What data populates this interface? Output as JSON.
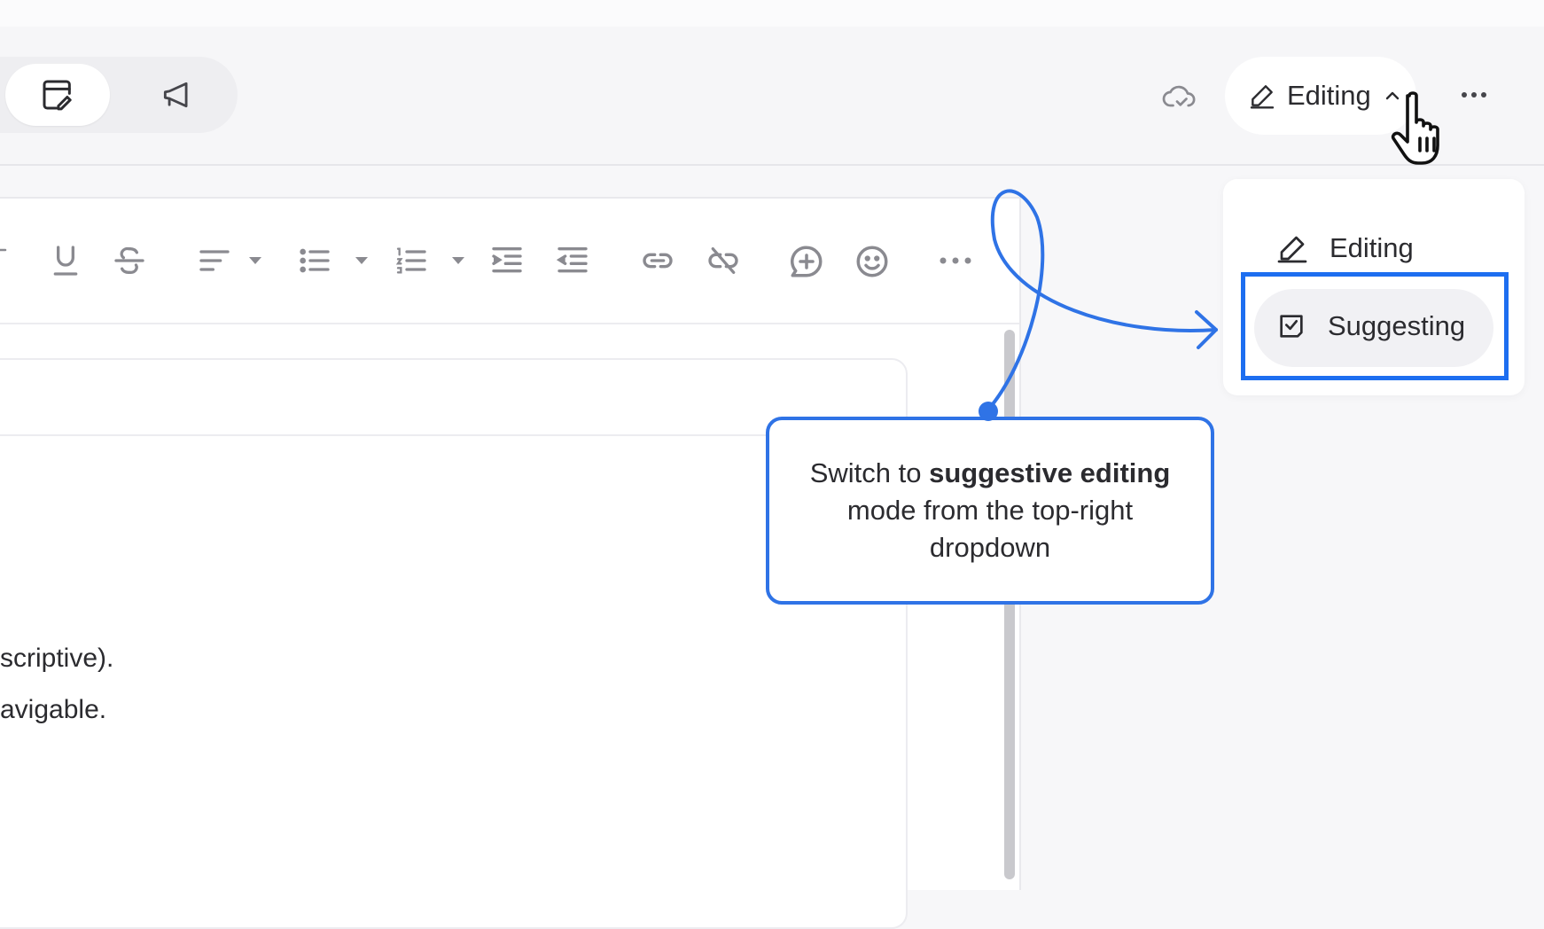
{
  "topbar": {
    "view_toggle": [
      {
        "icon": "edit-document-icon",
        "active": true
      },
      {
        "icon": "megaphone-icon",
        "active": false
      }
    ],
    "sync_icon": "cloud-check-icon",
    "mode_button": {
      "icon": "pencil-icon",
      "label": "Editing",
      "chevron": "chevron-up-icon"
    },
    "more_icon": "more-horizontal-icon"
  },
  "toolbar": {
    "tools": [
      "underline-icon",
      "strikethrough-icon",
      "align-icon",
      "bullet-list-icon",
      "numbered-list-icon",
      "indent-icon",
      "outdent-icon",
      "link-icon",
      "unlink-icon",
      "add-comment-icon",
      "emoji-icon",
      "more-horizontal-icon"
    ]
  },
  "document": {
    "lines": [
      "scriptive).",
      "avigable."
    ]
  },
  "dropdown": {
    "items": [
      {
        "icon": "pencil-icon",
        "label": "Editing"
      },
      {
        "icon": "suggest-check-icon",
        "label": "Suggesting"
      }
    ]
  },
  "callout": {
    "part1": "Switch to ",
    "bold1": "suggestive editing",
    "part2": " mode from the top-right dropdown"
  },
  "colors": {
    "accent": "#1d6ef0",
    "callout_border": "#2f73e6",
    "text": "#2b2b2f",
    "icon": "#8a8a90"
  }
}
